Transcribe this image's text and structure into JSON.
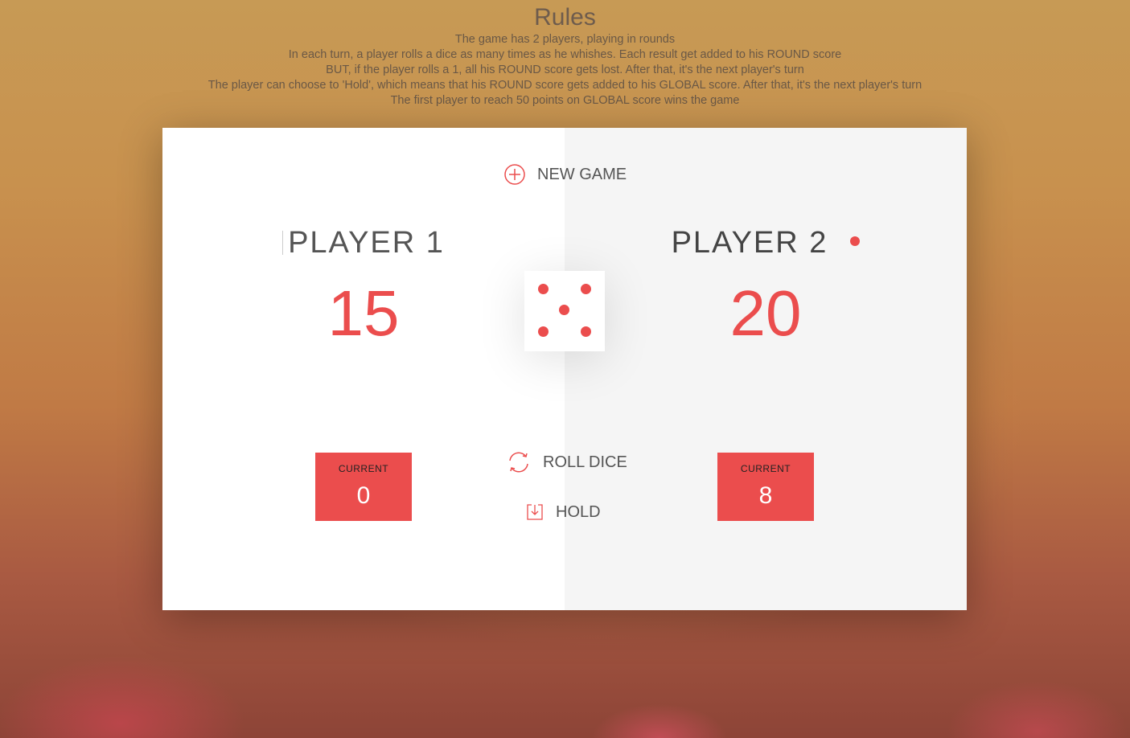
{
  "rules": {
    "title": "Rules",
    "lines": [
      "The game has 2 players, playing in rounds",
      "In each turn, a player rolls a dice as many times as he whishes. Each result get added to his ROUND score",
      "BUT, if the player rolls a 1, all his ROUND score gets lost. After that, it's the next player's turn",
      "The player can choose to 'Hold', which means that his ROUND score gets added to his GLOBAL score. After that, it's the next player's turn",
      "The first player to reach 50 points on GLOBAL score wins the game"
    ]
  },
  "buttons": {
    "new_game": "NEW GAME",
    "roll_dice": "ROLL DICE",
    "hold": "HOLD"
  },
  "players": [
    {
      "name": "PLAYER 1",
      "score": "15",
      "current_label": "CURRENT",
      "current_value": "0",
      "active": false
    },
    {
      "name": "PLAYER 2",
      "score": "20",
      "current_label": "CURRENT",
      "current_value": "8",
      "active": true
    }
  ],
  "dice": {
    "value": 5
  },
  "colors": {
    "accent": "#eb4d4d",
    "left_panel": "#ffffff",
    "right_panel": "#f5f5f5"
  },
  "icons": {
    "new_game": "plus-circle-icon",
    "roll_dice": "refresh-icon",
    "hold": "download-icon"
  }
}
